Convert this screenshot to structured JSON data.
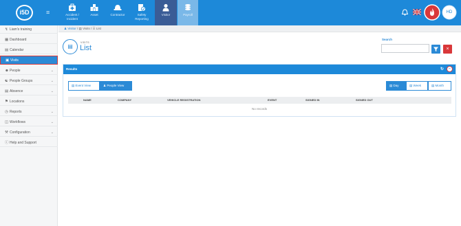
{
  "app": {
    "logo_text": "i5D",
    "menu_icon": "hamburger-icon"
  },
  "nav": [
    {
      "id": "accident",
      "label": "Accident / Incident",
      "icon": "first-aid-icon"
    },
    {
      "id": "asset",
      "label": "Asset",
      "icon": "asset-icon"
    },
    {
      "id": "contractor",
      "label": "Contractor",
      "icon": "hardhat-icon"
    },
    {
      "id": "safety",
      "label": "Safety Reporting",
      "icon": "safety-report-icon"
    },
    {
      "id": "visitor",
      "label": "Visitor",
      "icon": "person-icon",
      "active": true
    },
    {
      "id": "payroll",
      "label": "Payroll",
      "icon": "coins-icon"
    }
  ],
  "top_right": {
    "user_initials": "HD",
    "icons": [
      "bell-icon",
      "uk-flag-icon",
      "fire-alert-icon"
    ]
  },
  "sidebar": {
    "items": [
      {
        "label": "Liam's training",
        "icon": "training-icon",
        "chevron": false
      },
      {
        "label": "Dashboard",
        "icon": "dashboard-icon",
        "chevron": false
      },
      {
        "label": "Calendar",
        "icon": "calendar-icon",
        "chevron": false
      },
      {
        "label": "Visits",
        "icon": "visits-icon",
        "chevron": false,
        "active": true
      },
      {
        "label": "People",
        "icon": "people-icon",
        "chevron": true
      },
      {
        "label": "People Groups",
        "icon": "people-groups-icon",
        "chevron": true
      },
      {
        "label": "Absence",
        "icon": "absence-icon",
        "chevron": true
      },
      {
        "label": "Locations",
        "icon": "locations-icon",
        "chevron": false
      },
      {
        "label": "Reports",
        "icon": "reports-icon",
        "chevron": true
      },
      {
        "label": "Workflows",
        "icon": "workflows-icon",
        "chevron": true
      },
      {
        "label": "Configuration",
        "icon": "configuration-icon",
        "chevron": true
      },
      {
        "label": "Help and Support",
        "icon": "help-icon",
        "chevron": false
      }
    ]
  },
  "breadcrumb": {
    "visitor": "Visitor",
    "visits": "Visits",
    "list": "List",
    "sep": "/"
  },
  "page": {
    "subtitle": "VISITS",
    "title": "List"
  },
  "search": {
    "label": "Search",
    "placeholder": ""
  },
  "results": {
    "title": "Results",
    "left_views": [
      {
        "label": "Event View",
        "active": false
      },
      {
        "label": "People View",
        "active": true
      }
    ],
    "right_views": [
      {
        "label": "Day",
        "active": true
      },
      {
        "label": "Week",
        "active": false
      },
      {
        "label": "Month",
        "active": false
      }
    ],
    "columns": [
      "NAME",
      "COMPANY",
      "VEHICLE REGISTRATION",
      "EVENT",
      "SIGNED IN",
      "SIGNED OUT"
    ],
    "empty_text": "No records"
  },
  "colors": {
    "primary": "#1d89d9",
    "active_nav": "#3a5c96",
    "danger": "#d9383a"
  }
}
